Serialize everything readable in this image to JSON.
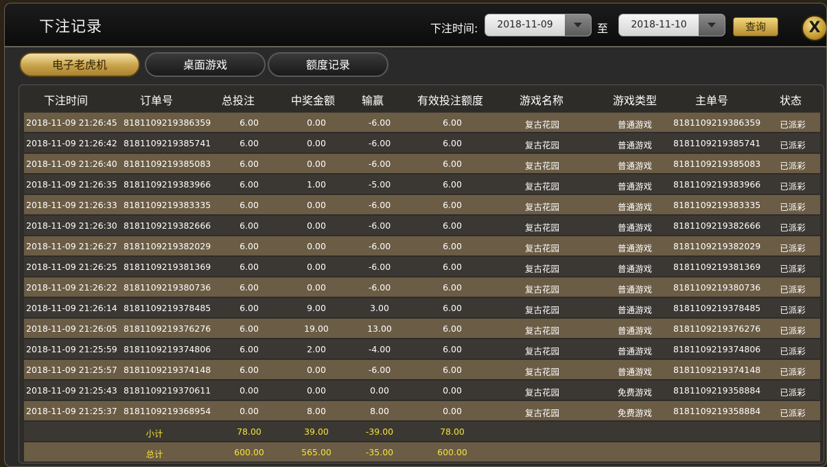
{
  "title": "下注记录",
  "filter": {
    "time_label": "下注时间:",
    "start_date": "2018-11-09",
    "to_label": "至",
    "end_date": "2018-11-10",
    "query_label": "查询",
    "close_label": "X"
  },
  "tabs": [
    {
      "label": "电子老虎机",
      "active": true
    },
    {
      "label": "桌面游戏",
      "active": false
    },
    {
      "label": "额度记录",
      "active": false
    }
  ],
  "columns": [
    "下注时间",
    "订单号",
    "总投注",
    "中奖金额",
    "输赢",
    "有效投注额度",
    "游戏名称",
    "游戏类型",
    "主单号",
    "状态"
  ],
  "rows": [
    [
      "2018-11-09 21:26:45",
      "8181109219386359",
      "6.00",
      "0.00",
      "-6.00",
      "6.00",
      "复古花园",
      "普通游戏",
      "8181109219386359",
      "已派彩"
    ],
    [
      "2018-11-09 21:26:42",
      "8181109219385741",
      "6.00",
      "0.00",
      "-6.00",
      "6.00",
      "复古花园",
      "普通游戏",
      "8181109219385741",
      "已派彩"
    ],
    [
      "2018-11-09 21:26:40",
      "8181109219385083",
      "6.00",
      "0.00",
      "-6.00",
      "6.00",
      "复古花园",
      "普通游戏",
      "8181109219385083",
      "已派彩"
    ],
    [
      "2018-11-09 21:26:35",
      "8181109219383966",
      "6.00",
      "1.00",
      "-5.00",
      "6.00",
      "复古花园",
      "普通游戏",
      "8181109219383966",
      "已派彩"
    ],
    [
      "2018-11-09 21:26:33",
      "8181109219383335",
      "6.00",
      "0.00",
      "-6.00",
      "6.00",
      "复古花园",
      "普通游戏",
      "8181109219383335",
      "已派彩"
    ],
    [
      "2018-11-09 21:26:30",
      "8181109219382666",
      "6.00",
      "0.00",
      "-6.00",
      "6.00",
      "复古花园",
      "普通游戏",
      "8181109219382666",
      "已派彩"
    ],
    [
      "2018-11-09 21:26:27",
      "8181109219382029",
      "6.00",
      "0.00",
      "-6.00",
      "6.00",
      "复古花园",
      "普通游戏",
      "8181109219382029",
      "已派彩"
    ],
    [
      "2018-11-09 21:26:25",
      "8181109219381369",
      "6.00",
      "0.00",
      "-6.00",
      "6.00",
      "复古花园",
      "普通游戏",
      "8181109219381369",
      "已派彩"
    ],
    [
      "2018-11-09 21:26:22",
      "8181109219380736",
      "6.00",
      "0.00",
      "-6.00",
      "6.00",
      "复古花园",
      "普通游戏",
      "8181109219380736",
      "已派彩"
    ],
    [
      "2018-11-09 21:26:14",
      "8181109219378485",
      "6.00",
      "9.00",
      "3.00",
      "6.00",
      "复古花园",
      "普通游戏",
      "8181109219378485",
      "已派彩"
    ],
    [
      "2018-11-09 21:26:05",
      "8181109219376276",
      "6.00",
      "19.00",
      "13.00",
      "6.00",
      "复古花园",
      "普通游戏",
      "8181109219376276",
      "已派彩"
    ],
    [
      "2018-11-09 21:25:59",
      "8181109219374806",
      "6.00",
      "2.00",
      "-4.00",
      "6.00",
      "复古花园",
      "普通游戏",
      "8181109219374806",
      "已派彩"
    ],
    [
      "2018-11-09 21:25:57",
      "8181109219374148",
      "6.00",
      "0.00",
      "-6.00",
      "6.00",
      "复古花园",
      "普通游戏",
      "8181109219374148",
      "已派彩"
    ],
    [
      "2018-11-09 21:25:43",
      "8181109219370611",
      "0.00",
      "0.00",
      "0.00",
      "0.00",
      "复古花园",
      "免费游戏",
      "8181109219358884",
      "已派彩"
    ],
    [
      "2018-11-09 21:25:37",
      "8181109219368954",
      "0.00",
      "8.00",
      "8.00",
      "0.00",
      "复古花园",
      "免费游戏",
      "8181109219358884",
      "已派彩"
    ]
  ],
  "subtotal": {
    "label": "小计",
    "bet": "78.00",
    "win": "39.00",
    "net": "-39.00",
    "valid": "78.00"
  },
  "total": {
    "label": "总计",
    "bet": "600.00",
    "win": "565.00",
    "net": "-35.00",
    "valid": "600.00"
  },
  "colors": {
    "row_odd": "#6b5c45",
    "row_even": "#3b3833",
    "summary_text": "#f4e33a",
    "tab_active": "#c9a24a"
  }
}
